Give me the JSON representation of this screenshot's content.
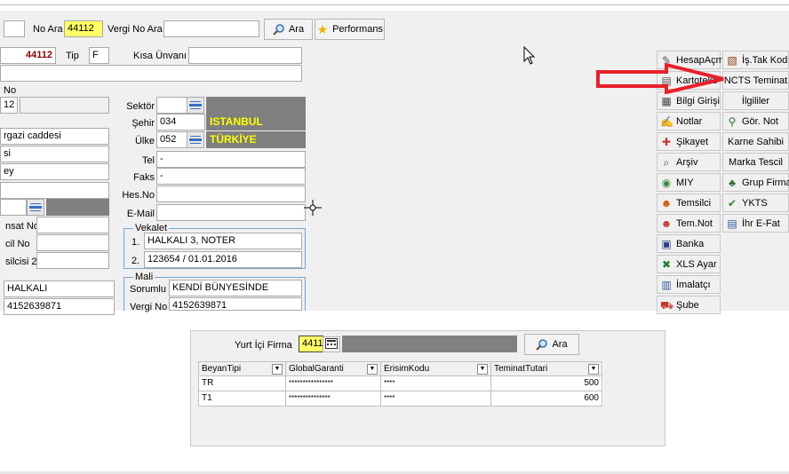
{
  "toolbar": {
    "no_ara_label": "No Ara",
    "no_ara_value": "44112",
    "vergi_no_ara_label": "Vergi No Ara",
    "vergi_no_ara_value": "",
    "ara_label": "Ara",
    "performans_label": "Performans"
  },
  "form": {
    "no_value": "44112",
    "tip_label": "Tip",
    "tip_value": "F",
    "kisa_unvani_label": "Kısa Ünvanı",
    "kisa_unvani_value": "",
    "no_label": "No",
    "no_partial_value": "12",
    "sektor_label": "Sektör",
    "sehir_label": "Şehir",
    "sehir_code": "034",
    "sehir_name": "ISTANBUL",
    "ulke_label": "Ülke",
    "ulke_code": "052",
    "ulke_name": "TÜRKİYE",
    "address_line1": "rgazi caddesi",
    "address_line2": "si",
    "address_line3": "ey",
    "tel_label": "Tel",
    "tel_value": "-",
    "faks_label": "Faks",
    "faks_value": "-",
    "hes_no_label": "Hes.No",
    "email_label": "E-Mail",
    "left_label1": "nsat No",
    "left_label2": "cil No",
    "left_label3": "silcisi 2",
    "vekalet_title": "Vekalet",
    "vekalet_1_num": "1.",
    "vekalet_1_value": "HALKALI 3, NOTER",
    "vekalet_2_num": "2.",
    "vekalet_2_value": "123654 / 01.01.2016",
    "left_city": "HALKALI",
    "left_vergi": "4152639871",
    "mali_title": "Mali",
    "sorumlu_label": "Sorumlu",
    "sorumlu_value": "KENDİ BÜNYESİNDE",
    "vergi_no_label": "Vergi No",
    "vergi_no_value": "4152639871"
  },
  "side_buttons_col1": [
    {
      "label": "HesapAçma",
      "icon": "eraser-icon"
    },
    {
      "label": "Kartoteks",
      "icon": "cards-icon"
    },
    {
      "label": "Bilgi Girişi",
      "icon": "pages-icon"
    },
    {
      "label": "Notlar",
      "icon": "note-icon"
    },
    {
      "label": "Şikayet",
      "icon": "complaint-icon"
    },
    {
      "label": "Arşiv",
      "icon": "archive-icon"
    },
    {
      "label": "MIY",
      "icon": "globe-icon"
    },
    {
      "label": "Temsilci",
      "icon": "people-icon"
    },
    {
      "label": "Tem.Not",
      "icon": "people-note-icon"
    },
    {
      "label": "Banka",
      "icon": "bank-icon"
    },
    {
      "label": "XLS Ayar",
      "icon": "excel-icon"
    },
    {
      "label": "İmalatçı",
      "icon": "factory-icon"
    },
    {
      "label": "Şube",
      "icon": "branch-icon"
    }
  ],
  "side_buttons_col2": [
    {
      "label": "İş.Tak Kod",
      "icon": "clipboard-icon"
    },
    {
      "label": "NCTS Teminat",
      "icon": ""
    },
    {
      "label": "İlgililer",
      "icon": ""
    },
    {
      "label": "Gör. Not",
      "icon": "magnifier-note-icon"
    },
    {
      "label": "Karne Sahibi",
      "icon": ""
    },
    {
      "label": "Marka Tescil",
      "icon": ""
    },
    {
      "label": "Grup Firma",
      "icon": "group-icon"
    },
    {
      "label": "YKTS",
      "icon": "check-icon"
    },
    {
      "label": "İhr E-Fat",
      "icon": "invoice-icon"
    }
  ],
  "bottom": {
    "yurt_ici_firma_label": "Yurt İçi Firma",
    "firma_value": "4411",
    "firma_name": "",
    "ara_label": "Ara",
    "columns": [
      "BeyanTipi",
      "GlobalGaranti",
      "ErisimKodu",
      "TeminatTutari"
    ],
    "rows": [
      [
        "TR",
        "****************",
        "****",
        "500"
      ],
      [
        "T1",
        "***************",
        "****",
        "600"
      ]
    ]
  },
  "colors": {
    "arrow": "#e8202a",
    "highlight": "#ffff66",
    "readonly_gray": "#808080",
    "fieldset_border": "#6fa6d6"
  }
}
